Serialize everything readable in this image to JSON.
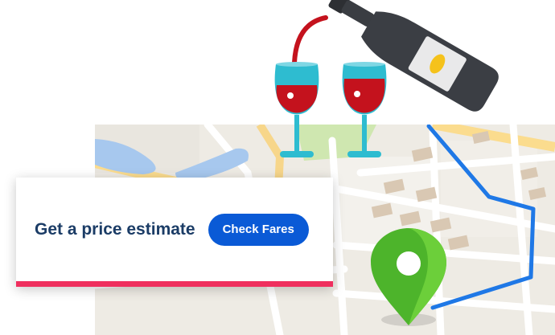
{
  "promo": {
    "title": "Get a price estimate",
    "cta_label": "Check Fares"
  },
  "colors": {
    "accent_stripe": "#ef2f5e",
    "cta_background": "#0a5ad6",
    "title_text": "#1b3c66",
    "route_line": "#1f78e6",
    "pin": "#55c02a",
    "wine": "#c4121d",
    "glass": "#2ebcd0"
  },
  "icons": [
    "map-illustration",
    "wine-bottle-icon",
    "wine-glass-icon",
    "location-pin-icon",
    "route-line"
  ]
}
